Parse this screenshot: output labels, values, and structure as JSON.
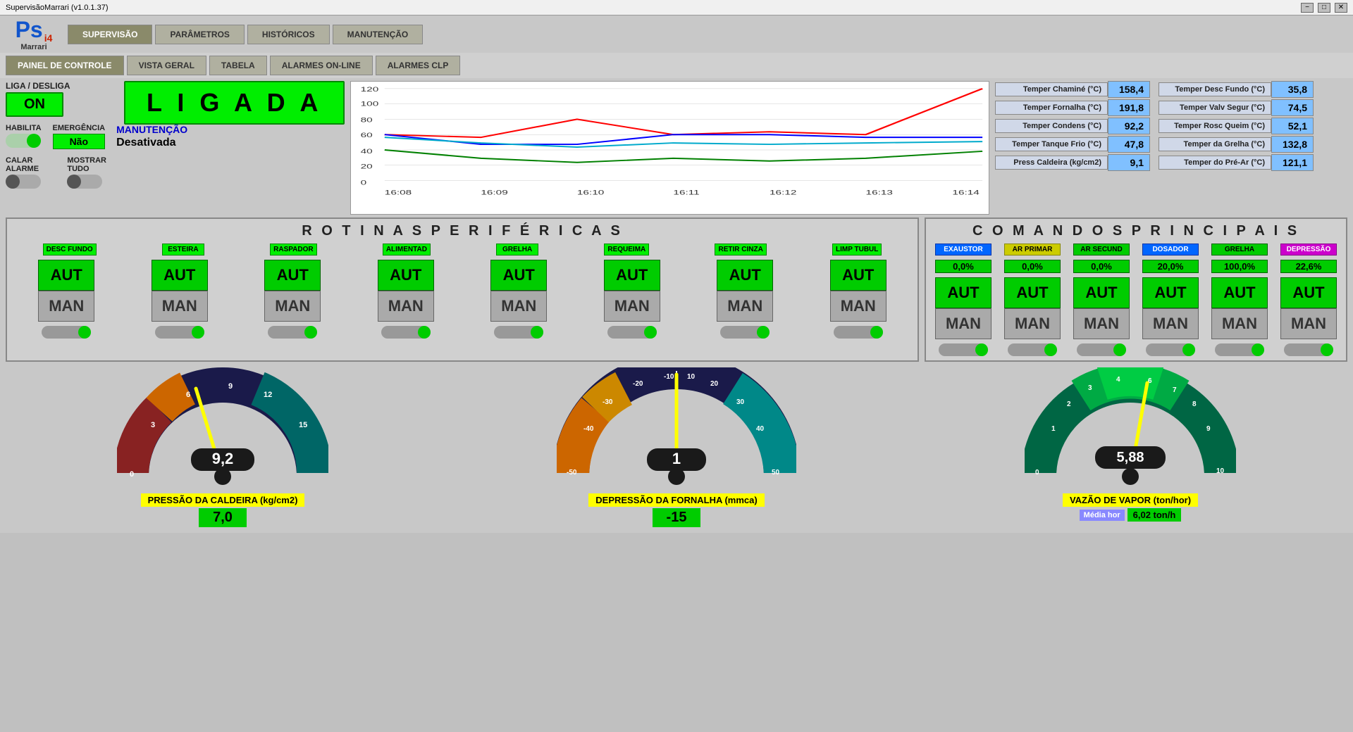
{
  "titlebar": {
    "title": "SupervisãoMarrari (v1.0.1.37)",
    "minimize": "−",
    "maximize": "□",
    "close": "✕"
  },
  "menus": {
    "main": [
      {
        "label": "SUPERVISÃO",
        "active": true
      },
      {
        "label": "PARÂMETROS",
        "active": false
      },
      {
        "label": "HISTÓRICOS",
        "active": false
      },
      {
        "label": "MANUTENÇÃO",
        "active": false
      }
    ],
    "sub": [
      {
        "label": "PAINEL DE CONTROLE",
        "active": true
      },
      {
        "label": "VISTA GERAL",
        "active": false
      },
      {
        "label": "TABELA",
        "active": false
      },
      {
        "label": "ALARMES ON-LINE",
        "active": false
      },
      {
        "label": "ALARMES CLP",
        "active": false
      }
    ]
  },
  "controls": {
    "liga_label": "LIGA / DESLIGA",
    "on_label": "ON",
    "ligada_label": "L I G A D A",
    "habilita_label": "HABILITA",
    "emergencia_label": "EMERGÊNCIA",
    "emergencia_value": "Não",
    "manutencao_label": "MANUTENÇÃO",
    "manutencao_value": "Desativada",
    "calar_label": "CALAR ALARME",
    "mostrar_label": "MOSTRAR TUDO"
  },
  "sensors": [
    {
      "name": "Temper Chaminé (°C)",
      "value": "158,4"
    },
    {
      "name": "Temper Desc Fundo (°C)",
      "value": "35,8"
    },
    {
      "name": "Temper Fornalha (°C)",
      "value": "191,8"
    },
    {
      "name": "Temper Valv Segur (°C)",
      "value": "74,5"
    },
    {
      "name": "Temper Condens (°C)",
      "value": "92,2"
    },
    {
      "name": "Temper Rosc Queim (°C)",
      "value": "52,1"
    },
    {
      "name": "Temper Tanque Frio (°C)",
      "value": "47,8"
    },
    {
      "name": "Temper da Grelha (°C)",
      "value": "132,8"
    },
    {
      "name": "Press Caldeira (kg/cm2)",
      "value": "9,1"
    },
    {
      "name": "Temper do Pré-Ar (°C)",
      "value": "121,1"
    }
  ],
  "rotinas": {
    "title": "R O T I N A S   P E R I F É R I C A S",
    "items": [
      {
        "name": "DESC FUNDO"
      },
      {
        "name": "ESTEIRA"
      },
      {
        "name": "RASPADOR"
      },
      {
        "name": "ALIMENTAD"
      },
      {
        "name": "GRELHA"
      },
      {
        "name": "REQUEIMA"
      },
      {
        "name": "RETIR CINZA"
      },
      {
        "name": "LIMP TUBUL"
      }
    ],
    "aut_label": "AUT",
    "man_label": "MAN"
  },
  "comandos": {
    "title": "C O M A N D O S   P R I N C I P A I S",
    "items": [
      {
        "name": "EXAUSTOR",
        "color": "blue",
        "percent": "0,0%"
      },
      {
        "name": "AR PRIMAR",
        "color": "yellow",
        "percent": "0,0%"
      },
      {
        "name": "AR SECUND",
        "color": "green",
        "percent": "0,0%"
      },
      {
        "name": "DOSADOR",
        "color": "blue",
        "percent": "20,0%"
      },
      {
        "name": "GRELHA",
        "color": "green",
        "percent": "100,0%"
      },
      {
        "name": "DEPRESSÃO",
        "color": "purple",
        "percent": "22,6%"
      }
    ],
    "aut_label": "AUT",
    "man_label": "MAN"
  },
  "gauges": {
    "pressao": {
      "title": "PRESSÃO DA CALDEIRA (kg/cm2)",
      "value": "9,2",
      "extra_value": "7,0",
      "min": 0,
      "max": 15,
      "needle_angle": -20
    },
    "depressao": {
      "title": "DEPRESSÃO DA FORNALHA (mmca)",
      "value": "1",
      "extra_value": "-15",
      "extra_color": "green",
      "min": -50,
      "max": 50,
      "needle_angle": 5
    },
    "vazao": {
      "title": "VAZÃO DE VAPOR (ton/hor)",
      "value": "5,88",
      "media_label": "Média hor",
      "media_value": "6,02 ton/h",
      "min": 0,
      "max": 10,
      "needle_angle": -30
    }
  }
}
